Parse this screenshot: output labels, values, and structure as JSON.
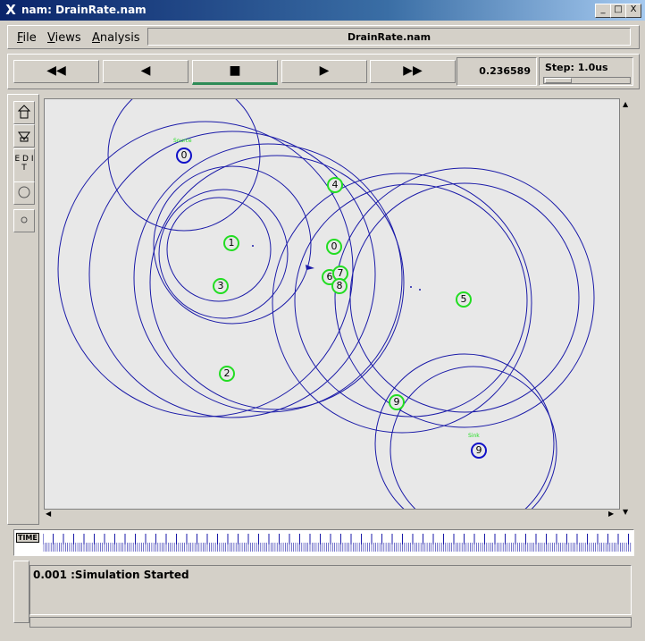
{
  "window": {
    "title": "nam: DrainRate.nam",
    "minimize": "_",
    "maximize": "□",
    "close": "X"
  },
  "menu": {
    "file": "File",
    "views": "Views",
    "analysis": "Analysis"
  },
  "filename": "DrainRate.nam",
  "transport": {
    "rewind": "◀◀",
    "back": "◀",
    "stop": "■",
    "play": "▶",
    "ffwd": "▶▶"
  },
  "time": "0.236589",
  "step": "Step: 1.0us",
  "side": {
    "edit": "E D I T"
  },
  "timeline_label": "TIME",
  "log": "0.001 :Simulation Started",
  "colors": {
    "node_green": "#22dd22",
    "node_blue": "#1010c8",
    "circle": "#1a1aa8"
  },
  "nodes": [
    {
      "id": "src",
      "label": "0",
      "role": "Source",
      "kind": "blue"
    },
    {
      "id": "n1",
      "label": "1",
      "kind": "green"
    },
    {
      "id": "n2",
      "label": "2",
      "kind": "green"
    },
    {
      "id": "n3",
      "label": "3",
      "kind": "green"
    },
    {
      "id": "n4",
      "label": "4",
      "kind": "green"
    },
    {
      "id": "n0",
      "label": "0",
      "kind": "green"
    },
    {
      "id": "n5",
      "label": "5",
      "kind": "green"
    },
    {
      "id": "n6",
      "label": "6",
      "kind": "green"
    },
    {
      "id": "n7",
      "label": "7",
      "kind": "green"
    },
    {
      "id": "n8",
      "label": "8",
      "kind": "green"
    },
    {
      "id": "n9",
      "label": "9",
      "kind": "green"
    },
    {
      "id": "sink",
      "label": "9",
      "role": "Sink",
      "kind": "blue"
    }
  ]
}
